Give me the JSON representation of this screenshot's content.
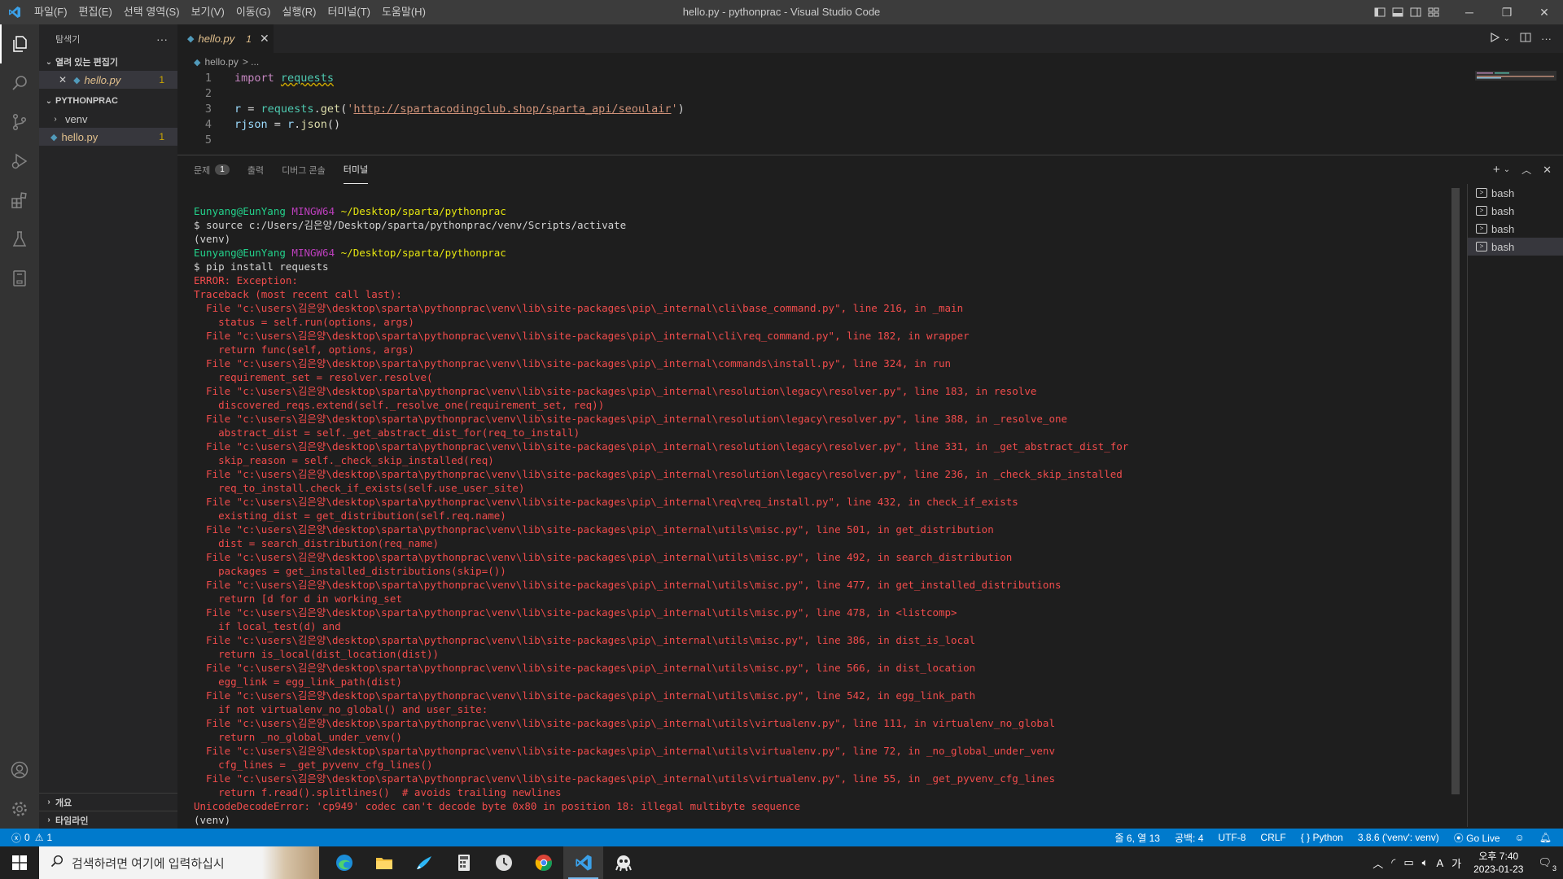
{
  "titlebar": {
    "menu": [
      "파일(F)",
      "편집(E)",
      "선택 영역(S)",
      "보기(V)",
      "이동(G)",
      "실행(R)",
      "터미널(T)",
      "도움말(H)"
    ],
    "title": "hello.py - pythonprac - Visual Studio Code"
  },
  "sidebar": {
    "header": "탐색기",
    "open_editors": "열려 있는 편집기",
    "open_file": "hello.py",
    "open_file_badge": "1",
    "project": "PYTHONPRAC",
    "folder": "venv",
    "file": "hello.py",
    "file_badge": "1",
    "outline": "개요",
    "timeline": "타임라인"
  },
  "editor": {
    "tab_name": "hello.py",
    "tab_badge": "1",
    "breadcrumb_file": "hello.py",
    "breadcrumb_rest": "> ...",
    "lines": [
      {
        "n": "1",
        "import": "import",
        "module": "requests"
      },
      {
        "n": "2"
      },
      {
        "n": "3",
        "var": "r",
        "eq": " = ",
        "obj": "requests",
        "fn": "get",
        "url": "http://spartacodingclub.shop/sparta_api/seoulair"
      },
      {
        "n": "4",
        "var": "rjson",
        "eq": " = ",
        "obj": "r",
        "fn": "json"
      },
      {
        "n": "5"
      }
    ]
  },
  "panel": {
    "tabs": {
      "problems": "문제",
      "problems_count": "1",
      "output": "출력",
      "debug": "디버그 콘솔",
      "terminal": "터미널"
    },
    "terminals": [
      "bash",
      "bash",
      "bash",
      "bash"
    ],
    "prompt_user": "Eunyang@EunYang",
    "prompt_host": "MINGW64",
    "prompt_path": "~/Desktop/sparta/pythonprac",
    "cmd1": "$ source c:/Users/김은양/Desktop/sparta/pythonprac/venv/Scripts/activate",
    "venv": "(venv)",
    "cmd2": "$ pip install requests",
    "error_lines": [
      "ERROR: Exception:",
      "Traceback (most recent call last):",
      "  File \"c:\\users\\김은양\\desktop\\sparta\\pythonprac\\venv\\lib\\site-packages\\pip\\_internal\\cli\\base_command.py\", line 216, in _main",
      "    status = self.run(options, args)",
      "  File \"c:\\users\\김은양\\desktop\\sparta\\pythonprac\\venv\\lib\\site-packages\\pip\\_internal\\cli\\req_command.py\", line 182, in wrapper",
      "    return func(self, options, args)",
      "  File \"c:\\users\\김은양\\desktop\\sparta\\pythonprac\\venv\\lib\\site-packages\\pip\\_internal\\commands\\install.py\", line 324, in run",
      "    requirement_set = resolver.resolve(",
      "  File \"c:\\users\\김은양\\desktop\\sparta\\pythonprac\\venv\\lib\\site-packages\\pip\\_internal\\resolution\\legacy\\resolver.py\", line 183, in resolve",
      "    discovered_reqs.extend(self._resolve_one(requirement_set, req))",
      "  File \"c:\\users\\김은양\\desktop\\sparta\\pythonprac\\venv\\lib\\site-packages\\pip\\_internal\\resolution\\legacy\\resolver.py\", line 388, in _resolve_one",
      "    abstract_dist = self._get_abstract_dist_for(req_to_install)",
      "  File \"c:\\users\\김은양\\desktop\\sparta\\pythonprac\\venv\\lib\\site-packages\\pip\\_internal\\resolution\\legacy\\resolver.py\", line 331, in _get_abstract_dist_for",
      "    skip_reason = self._check_skip_installed(req)",
      "  File \"c:\\users\\김은양\\desktop\\sparta\\pythonprac\\venv\\lib\\site-packages\\pip\\_internal\\resolution\\legacy\\resolver.py\", line 236, in _check_skip_installed",
      "    req_to_install.check_if_exists(self.use_user_site)",
      "  File \"c:\\users\\김은양\\desktop\\sparta\\pythonprac\\venv\\lib\\site-packages\\pip\\_internal\\req\\req_install.py\", line 432, in check_if_exists",
      "    existing_dist = get_distribution(self.req.name)",
      "  File \"c:\\users\\김은양\\desktop\\sparta\\pythonprac\\venv\\lib\\site-packages\\pip\\_internal\\utils\\misc.py\", line 501, in get_distribution",
      "    dist = search_distribution(req_name)",
      "  File \"c:\\users\\김은양\\desktop\\sparta\\pythonprac\\venv\\lib\\site-packages\\pip\\_internal\\utils\\misc.py\", line 492, in search_distribution",
      "    packages = get_installed_distributions(skip=())",
      "  File \"c:\\users\\김은양\\desktop\\sparta\\pythonprac\\venv\\lib\\site-packages\\pip\\_internal\\utils\\misc.py\", line 477, in get_installed_distributions",
      "    return [d for d in working_set",
      "  File \"c:\\users\\김은양\\desktop\\sparta\\pythonprac\\venv\\lib\\site-packages\\pip\\_internal\\utils\\misc.py\", line 478, in <listcomp>",
      "    if local_test(d) and",
      "  File \"c:\\users\\김은양\\desktop\\sparta\\pythonprac\\venv\\lib\\site-packages\\pip\\_internal\\utils\\misc.py\", line 386, in dist_is_local",
      "    return is_local(dist_location(dist))",
      "  File \"c:\\users\\김은양\\desktop\\sparta\\pythonprac\\venv\\lib\\site-packages\\pip\\_internal\\utils\\misc.py\", line 566, in dist_location",
      "    egg_link = egg_link_path(dist)",
      "  File \"c:\\users\\김은양\\desktop\\sparta\\pythonprac\\venv\\lib\\site-packages\\pip\\_internal\\utils\\misc.py\", line 542, in egg_link_path",
      "    if not virtualenv_no_global() and user_site:",
      "  File \"c:\\users\\김은양\\desktop\\sparta\\pythonprac\\venv\\lib\\site-packages\\pip\\_internal\\utils\\virtualenv.py\", line 111, in virtualenv_no_global",
      "    return _no_global_under_venv()",
      "  File \"c:\\users\\김은양\\desktop\\sparta\\pythonprac\\venv\\lib\\site-packages\\pip\\_internal\\utils\\virtualenv.py\", line 72, in _no_global_under_venv",
      "    cfg_lines = _get_pyvenv_cfg_lines()",
      "  File \"c:\\users\\김은양\\desktop\\sparta\\pythonprac\\venv\\lib\\site-packages\\pip\\_internal\\utils\\virtualenv.py\", line 55, in _get_pyvenv_cfg_lines",
      "    return f.read().splitlines()  # avoids trailing newlines",
      "UnicodeDecodeError: 'cp949' codec can't decode byte 0x80 in position 18: illegal multibyte sequence"
    ],
    "final_line": "(venv)"
  },
  "statusbar": {
    "errors": "0",
    "warnings": "1",
    "position": "줄 6, 열 13",
    "spaces": "공백: 4",
    "encoding": "UTF-8",
    "eol": "CRLF",
    "language": "Python",
    "interpreter": "3.8.6 ('venv': venv)",
    "golive": "Go Live"
  },
  "taskbar": {
    "search_placeholder": "검색하려면 여기에 입력하십시",
    "time": "오후 7:40",
    "date": "2023-01-23",
    "notification_count": "3",
    "ime_a": "A",
    "ime_lang": "가"
  },
  "colors": {
    "accent": "#007acc",
    "terminal_error": "#f14c4c",
    "prompt_green": "#23d18b",
    "prompt_magenta": "#bc3fbc",
    "prompt_yellow": "#e5e510"
  }
}
